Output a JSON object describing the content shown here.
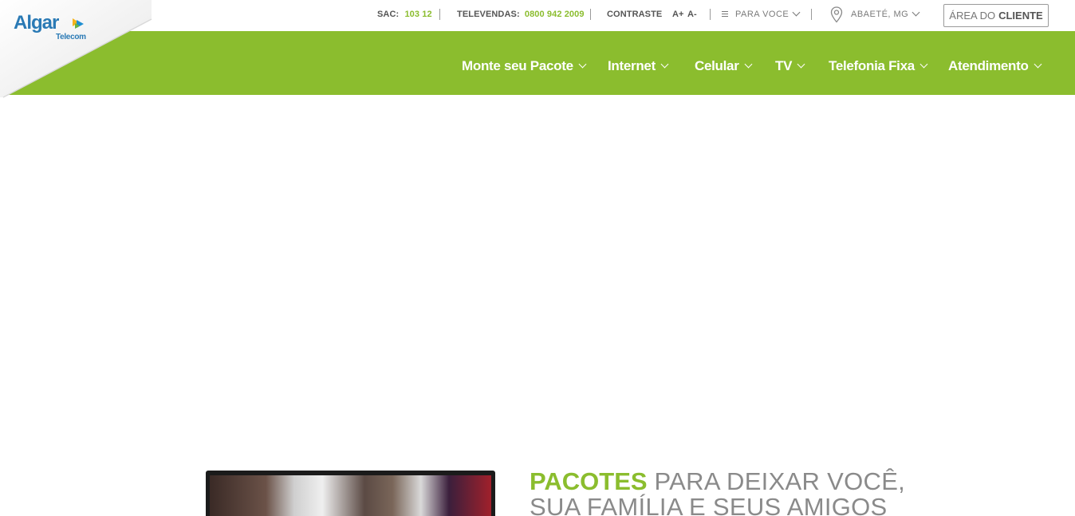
{
  "logo": {
    "name": "Algar",
    "sub": "Telecom"
  },
  "topbar": {
    "sac_label": "SAC:",
    "sac_value": "103 12",
    "televendas_label": "TELEVENDAS:",
    "televendas_value": "0800 942 2009",
    "contraste": "CONTRASTE",
    "font_increase": "A+",
    "font_decrease": "A-",
    "segment": "PARA VOCE",
    "location": "ABAETÉ, MG",
    "area_prefix": "ÁREA DO",
    "area_bold": "CLIENTE"
  },
  "nav": {
    "items": [
      {
        "label": "Monte seu Pacote"
      },
      {
        "label": "Internet"
      },
      {
        "label": "Celular"
      },
      {
        "label": "TV"
      },
      {
        "label": "Telefonia Fixa"
      },
      {
        "label": "Atendimento"
      }
    ]
  },
  "hero": {
    "highlight": "PACOTES",
    "line1_rest": "PARA DEIXAR VOCÊ,",
    "line2": "SUA FAMÍLIA E SEUS AMIGOS"
  },
  "colors": {
    "brand_green": "#8bbd2e",
    "brand_blue": "#2a7ab5"
  }
}
